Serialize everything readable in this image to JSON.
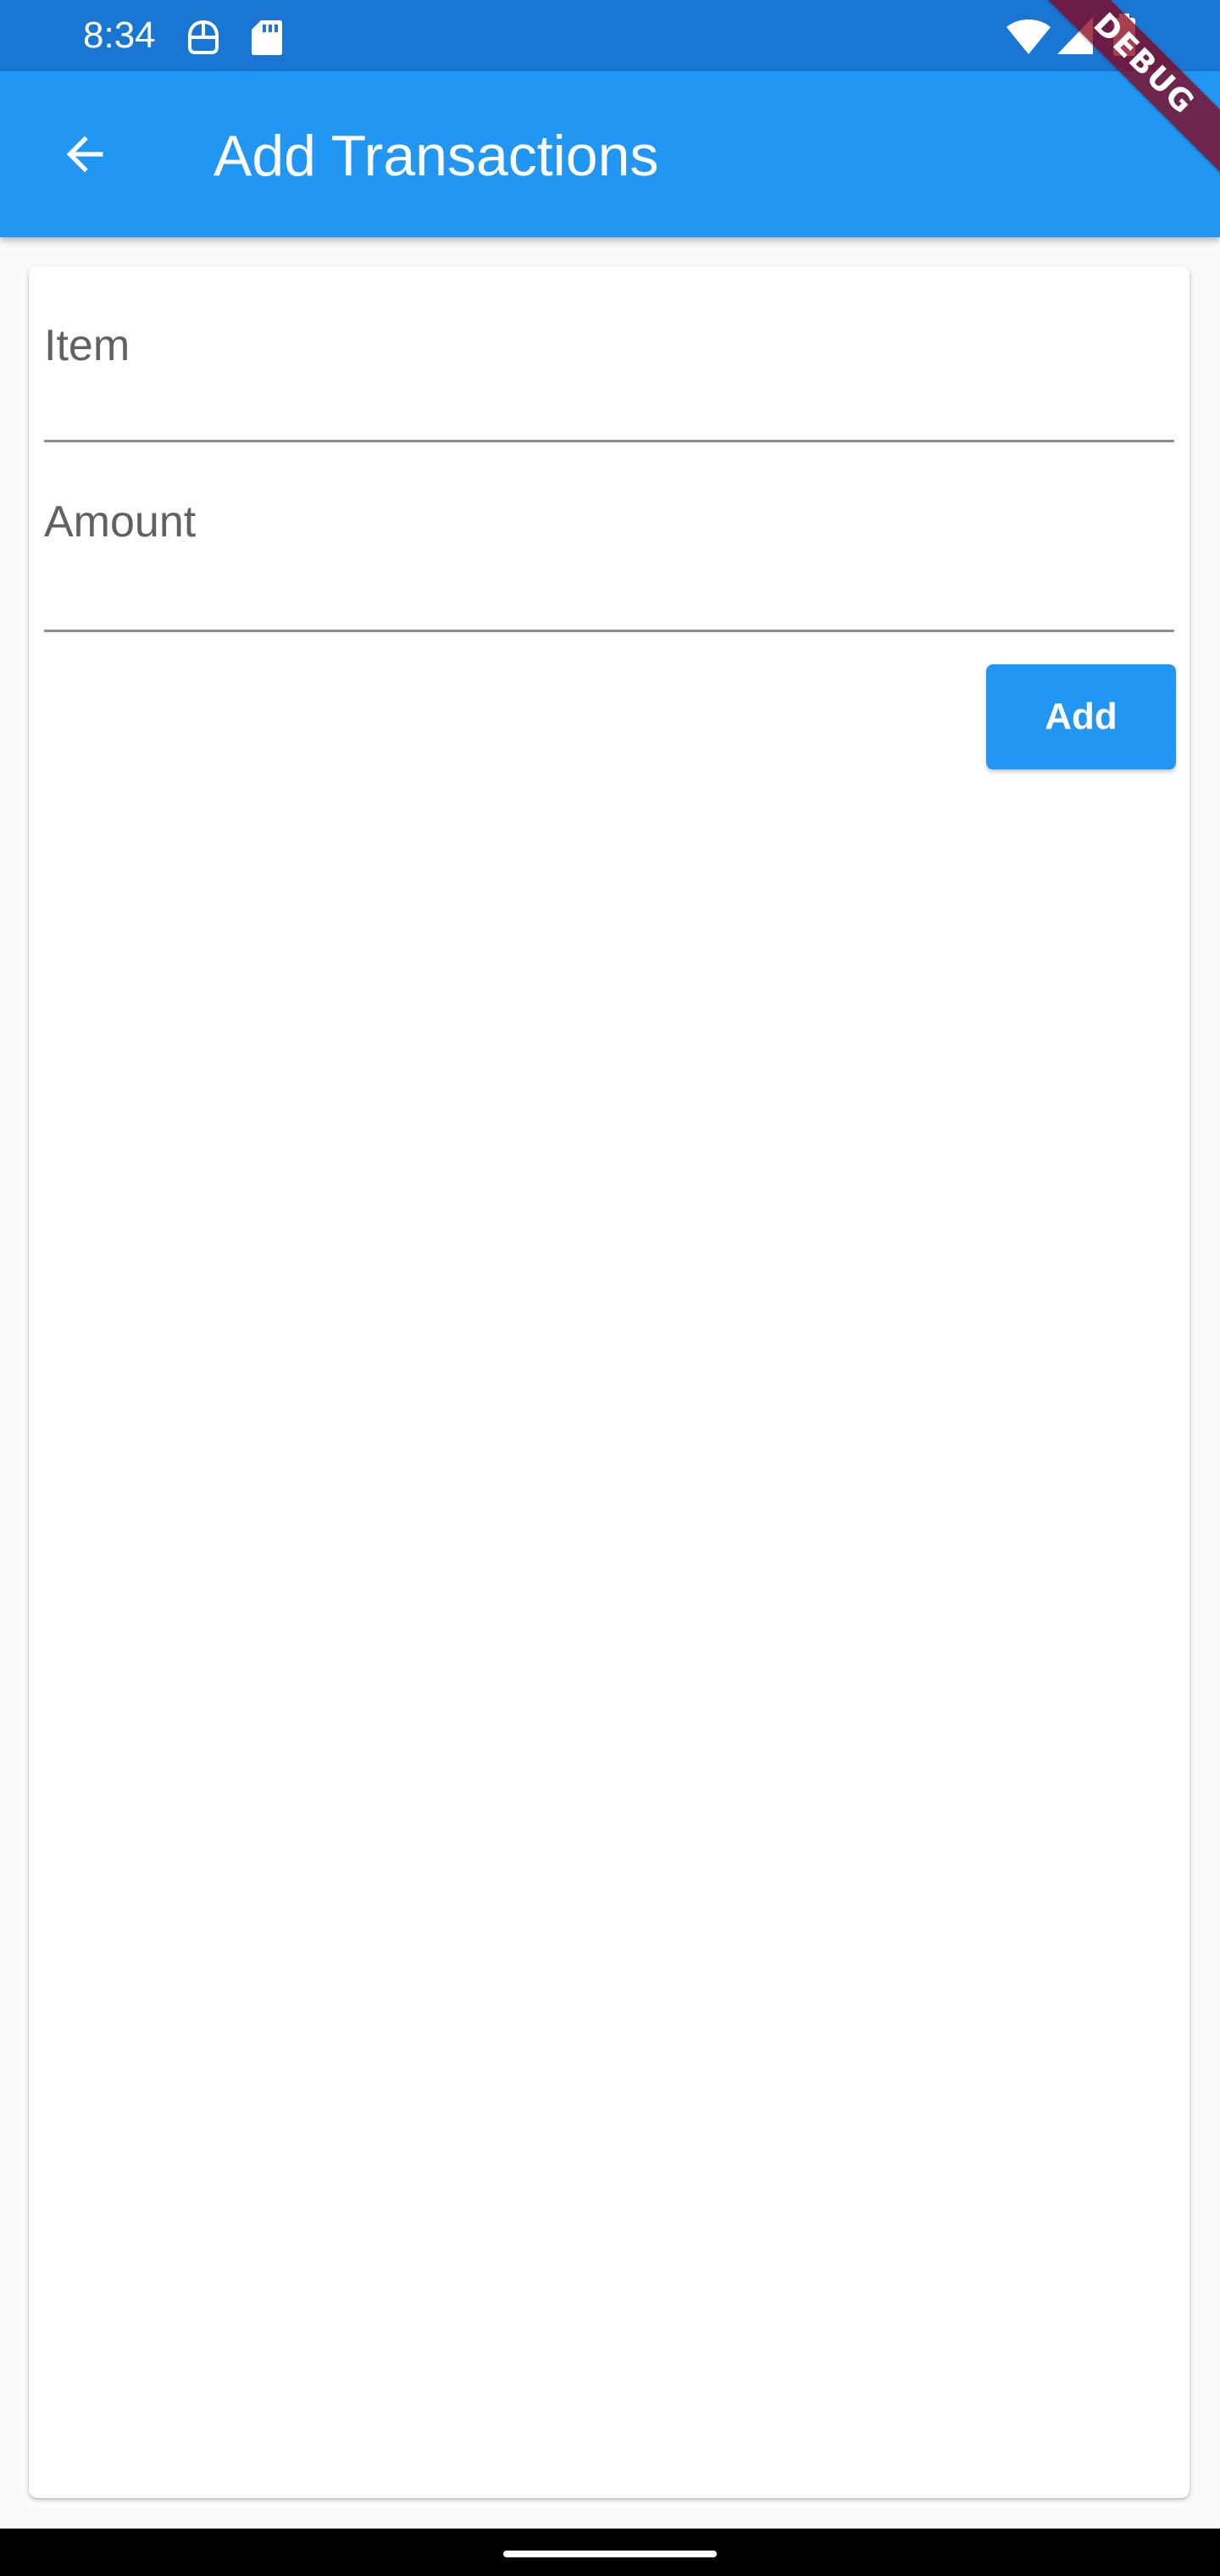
{
  "status_bar": {
    "time": "8:34",
    "icons": [
      "data-saver-icon",
      "sd-card-icon",
      "wifi-icon",
      "signal-icon",
      "battery-icon"
    ],
    "background": "#1976d2"
  },
  "app_bar": {
    "title": "Add Transactions",
    "back_icon": "arrow-back-icon",
    "background": "#2196f3"
  },
  "debug_banner": {
    "label": "DEBUG"
  },
  "form": {
    "item_field": {
      "label": "Item",
      "value": ""
    },
    "amount_field": {
      "label": "Amount",
      "value": ""
    },
    "add_button": {
      "label": "Add",
      "color": "#2196f3"
    }
  },
  "nav_bar": {
    "background": "#000000"
  }
}
